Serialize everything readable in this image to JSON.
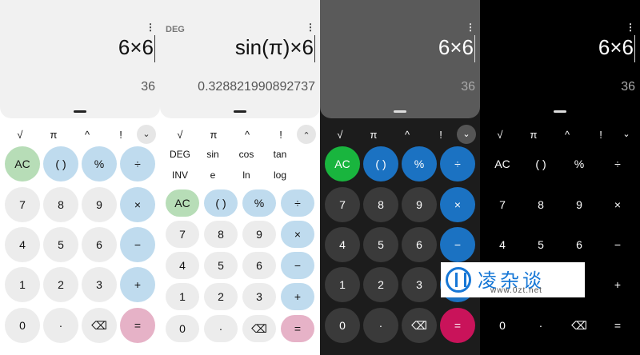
{
  "panel1": {
    "expression": "6×6",
    "result": "36"
  },
  "panel2": {
    "mode": "DEG",
    "expression": "sin(π)×6",
    "result": "0.328821990892737"
  },
  "panel3": {
    "expression": "6×6",
    "result": "36"
  },
  "panel4": {
    "expression": "6×6",
    "result": "36"
  },
  "menu_icon": "⋮",
  "functions": {
    "sqrt": "√",
    "pi": "π",
    "power": "^",
    "factorial": "!",
    "expand": "⌄"
  },
  "scientific": {
    "row1": [
      "DEG",
      "sin",
      "cos",
      "tan"
    ],
    "row2": [
      "INV",
      "e",
      "ln",
      "log"
    ]
  },
  "keys": {
    "ac": "AC",
    "parens": "( )",
    "percent": "%",
    "divide": "÷",
    "seven": "7",
    "eight": "8",
    "nine": "9",
    "multiply": "×",
    "four": "4",
    "five": "5",
    "six": "6",
    "minus": "−",
    "one": "1",
    "two": "2",
    "three": "3",
    "plus": "+",
    "zero": "0",
    "dot": "·",
    "backspace": "⌫",
    "equals": "="
  },
  "watermark": {
    "name": "凌杂谈",
    "url": "www.0zt.net"
  },
  "colors": {
    "light_operator": "#bfdbee",
    "light_ac": "#b7ddb7",
    "light_equals": "#e6b2c7",
    "dark_operator": "#1b72c2",
    "dark_ac": "#19b53e",
    "dark_equals": "#c9135a"
  }
}
